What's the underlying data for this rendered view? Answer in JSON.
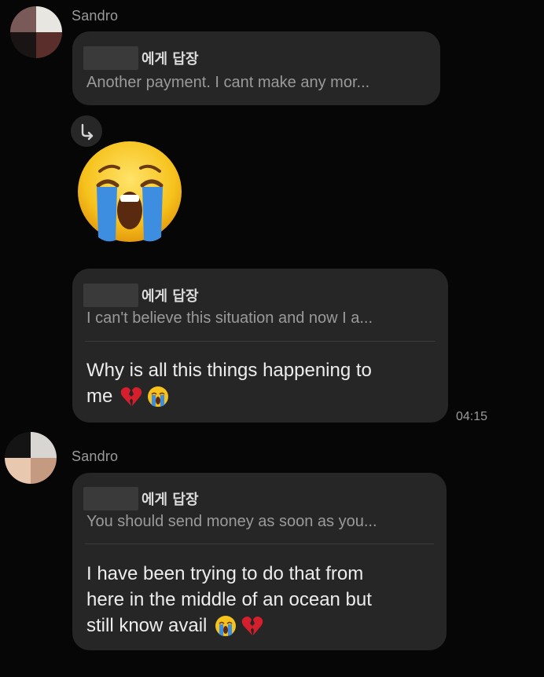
{
  "messages": [
    {
      "sender": "Sandro",
      "reply_label": "에게 답장",
      "quoted": "Another payment. I cant make any mor..."
    },
    {
      "emoji": "crying-face",
      "reply_label": "에게 답장",
      "quoted": "I can't believe this situation and now I a...",
      "text_line1": "Why is all this things happening to",
      "text_line2": "me",
      "timestamp": "04:15"
    },
    {
      "sender": "Sandro",
      "reply_label": "에게 답장",
      "quoted": "You should send money as soon as you...",
      "text_line1": "I have been trying to do that from",
      "text_line2": "here in the middle of an ocean but",
      "text_line3": "still know avail"
    }
  ],
  "colors": {
    "background": "#060606",
    "bubble": "#262626",
    "muted_text": "#9a9a9a",
    "emoji_yellow": "#f6c21c",
    "tear_blue": "#3d8ee0",
    "heart_red": "#d61f2c"
  },
  "icons": [
    "reply-arrow-icon",
    "crying-face-emoji",
    "broken-heart-emoji"
  ]
}
